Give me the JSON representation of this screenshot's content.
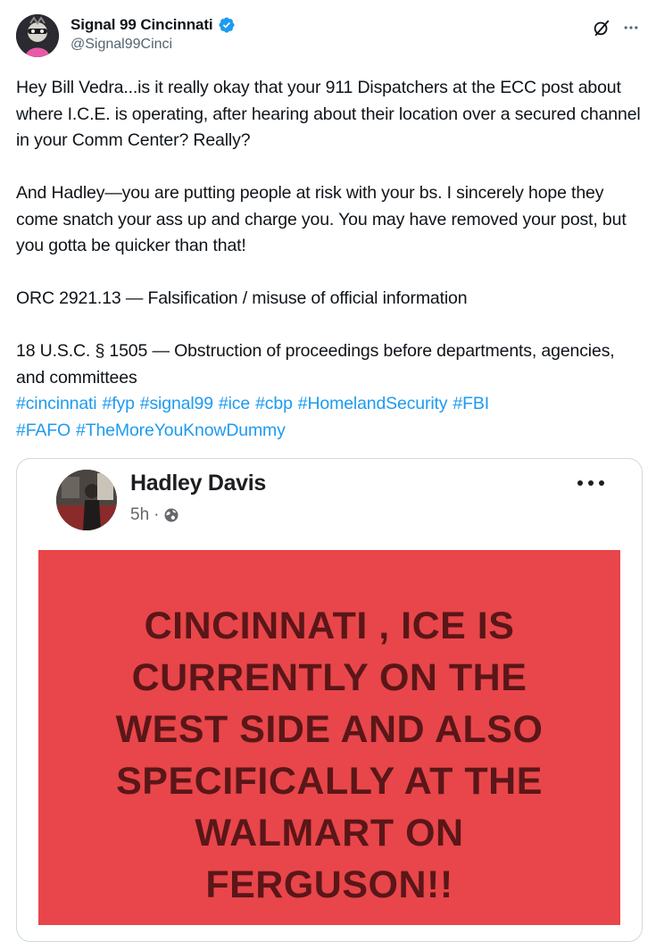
{
  "tweet": {
    "author": {
      "display_name": "Signal 99 Cincinnati",
      "handle": "@Signal99Cinci",
      "verified": true,
      "avatar_icon": "mascot-avatar-icon"
    },
    "top_actions": {
      "grok_icon": "grok-slash-icon",
      "more_icon": "more-horizontal-icon"
    },
    "body": {
      "paragraph1": "Hey Bill Vedra...is it really okay that your 911 Dispatchers at the ECC post about where I.C.E. is operating, after hearing about their location over a secured channel in your Comm Center? Really?",
      "paragraph2": "And Hadley—you are putting people at risk with your bs. I sincerely hope they come snatch your ass up and charge you. You may have removed your post, but you gotta be quicker than that!",
      "paragraph3": "ORC 2921.13 — Falsification / misuse of official information",
      "paragraph4": "18 U.S.C. § 1505 — Obstruction of proceedings before departments, agencies, and committees",
      "hashtags": [
        "#cincinnati",
        "#fyp",
        "#signal99",
        "#ice",
        "#cbp",
        "#HomelandSecurity",
        "#FBI",
        "#FAFO",
        "#TheMoreYouKnowDummy"
      ]
    },
    "accent_color": "#1d9bf0",
    "verified_color": "#1d9bf0"
  },
  "embedded_post": {
    "author_name": "Hadley Davis",
    "time": "5h",
    "separator": "·",
    "audience_icon": "globe-icon",
    "more_icon": "more-horizontal-icon",
    "banner": {
      "background_color": "#e8464a",
      "text_color": "#5a1618",
      "lines": [
        "CINCINNATI , ICE IS",
        "CURRENTLY ON THE",
        "WEST SIDE AND ALSO",
        "SPECIFICALLY AT THE",
        "WALMART ON",
        "FERGUSON!!"
      ]
    }
  }
}
